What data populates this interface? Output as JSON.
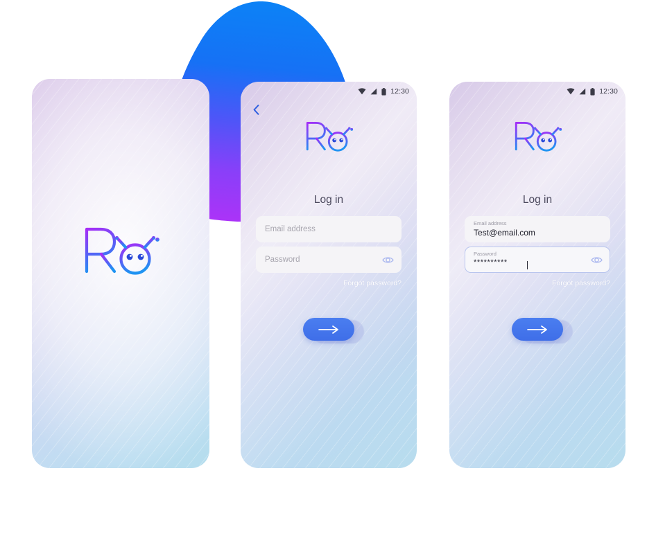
{
  "app": {
    "name": "Roi",
    "logo_text": "Roi",
    "logo_icon": "robot-head-logo",
    "accent_blue": "#2f6bf3",
    "accent_purple": "#9b3bf5",
    "button_blue": "#4173ea"
  },
  "status_bar": {
    "wifi_icon": "wifi-icon",
    "signal_icon": "cellular-signal-icon",
    "battery_icon": "battery-icon",
    "time": "12:30"
  },
  "screens": [
    {
      "id": "splash",
      "name": "splash-screen",
      "logo_text": "Roi",
      "has_status_bar": false,
      "has_back_button": false
    },
    {
      "id": "login-empty",
      "name": "login-screen-empty",
      "has_status_bar": true,
      "has_back_button": true,
      "back_icon": "chevron-left-icon",
      "logo_text": "Roi",
      "title": "Log in",
      "email_field": {
        "placeholder": "Email address",
        "value": "",
        "label": "Email address"
      },
      "password_field": {
        "placeholder": "Password",
        "value": "",
        "label": "Password",
        "toggle_icon": "eye-icon",
        "focused": false
      },
      "forgot_link": "Forgot password?",
      "submit_icon": "arrow-right-icon"
    },
    {
      "id": "login-filled",
      "name": "login-screen-filled",
      "has_status_bar": true,
      "has_back_button": false,
      "logo_text": "Roi",
      "title": "Log in",
      "email_field": {
        "label": "Email address",
        "value": "Test@email.com",
        "placeholder": "Email address"
      },
      "password_field": {
        "label": "Password",
        "value": "**********",
        "placeholder": "Password",
        "toggle_icon": "eye-icon",
        "focused": true
      },
      "forgot_link": "Forgot password?",
      "submit_icon": "arrow-right-icon"
    }
  ],
  "decoration": {
    "blob_name": "background-blob-shape",
    "gradient_top": "#0c7bf5",
    "gradient_bottom": "#a437f8"
  }
}
